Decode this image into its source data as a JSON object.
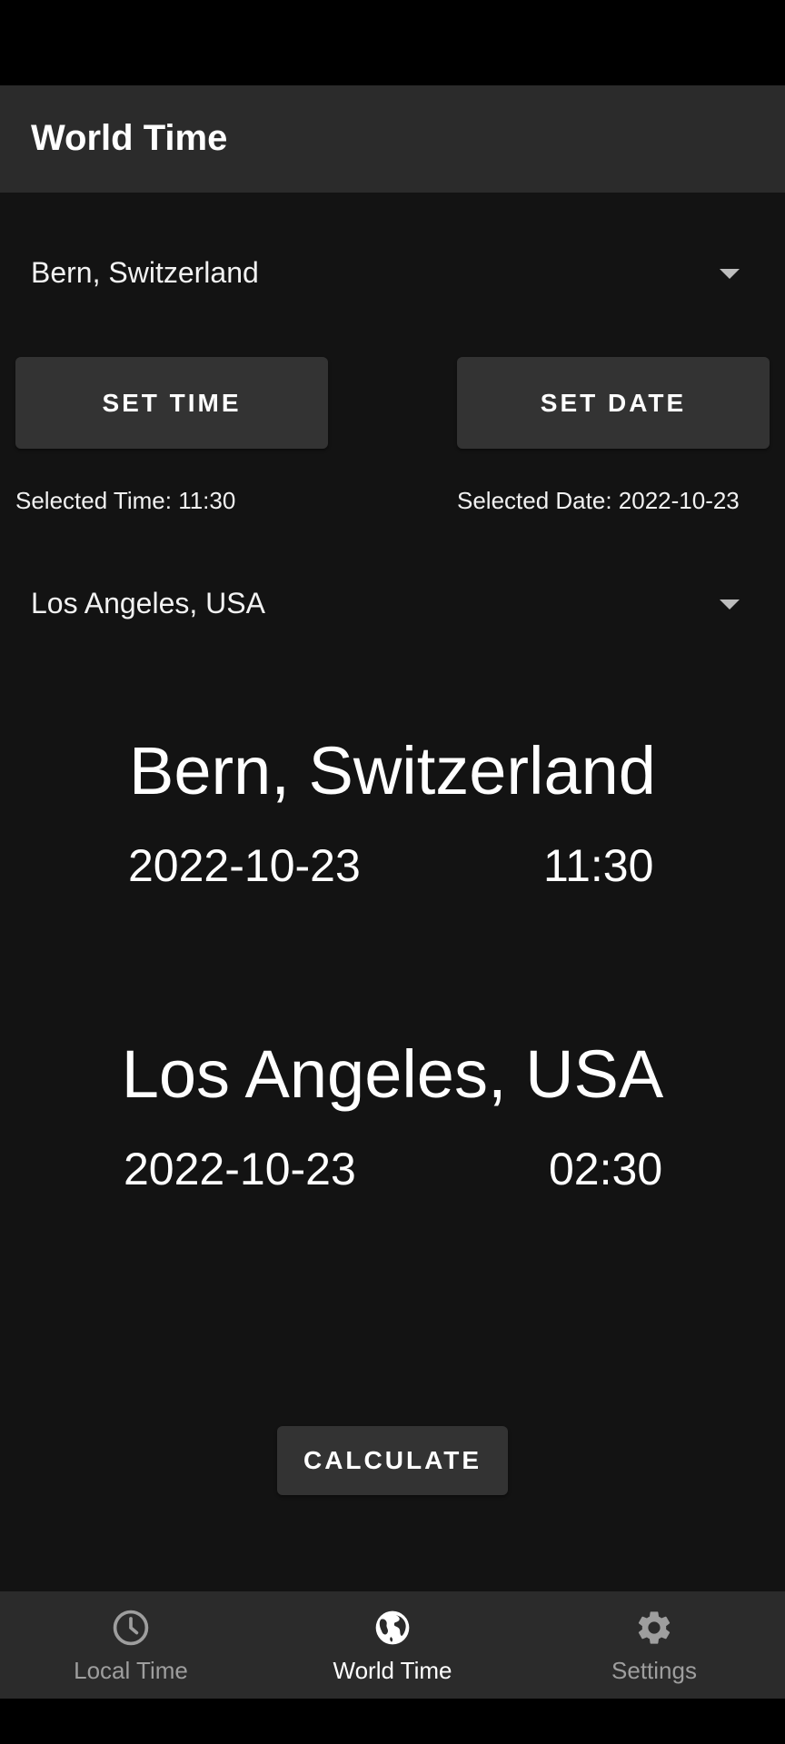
{
  "app_bar": {
    "title": "World Time"
  },
  "source_city": {
    "selected": "Bern, Switzerland"
  },
  "buttons": {
    "set_time": "SET TIME",
    "set_date": "SET DATE",
    "calculate": "CALCULATE"
  },
  "selected": {
    "time_text": "Selected Time: 11:30",
    "date_text": "Selected Date: 2022-10-23"
  },
  "target_city": {
    "selected": "Los Angeles, USA"
  },
  "results": {
    "source": {
      "name": "Bern, Switzerland",
      "date": "2022-10-23",
      "time": "11:30"
    },
    "target": {
      "name": "Los Angeles, USA",
      "date": "2022-10-23",
      "time": "02:30"
    }
  },
  "bottom_nav": {
    "items": [
      {
        "label": "Local Time",
        "icon": "clock-icon",
        "active": false
      },
      {
        "label": "World Time",
        "icon": "globe-icon",
        "active": true
      },
      {
        "label": "Settings",
        "icon": "gear-icon",
        "active": false
      }
    ]
  },
  "colors": {
    "background": "#131313",
    "app_bar": "#2b2b2b",
    "button": "#333333",
    "nav_inactive": "#9e9e9e",
    "nav_active": "#ffffff"
  }
}
